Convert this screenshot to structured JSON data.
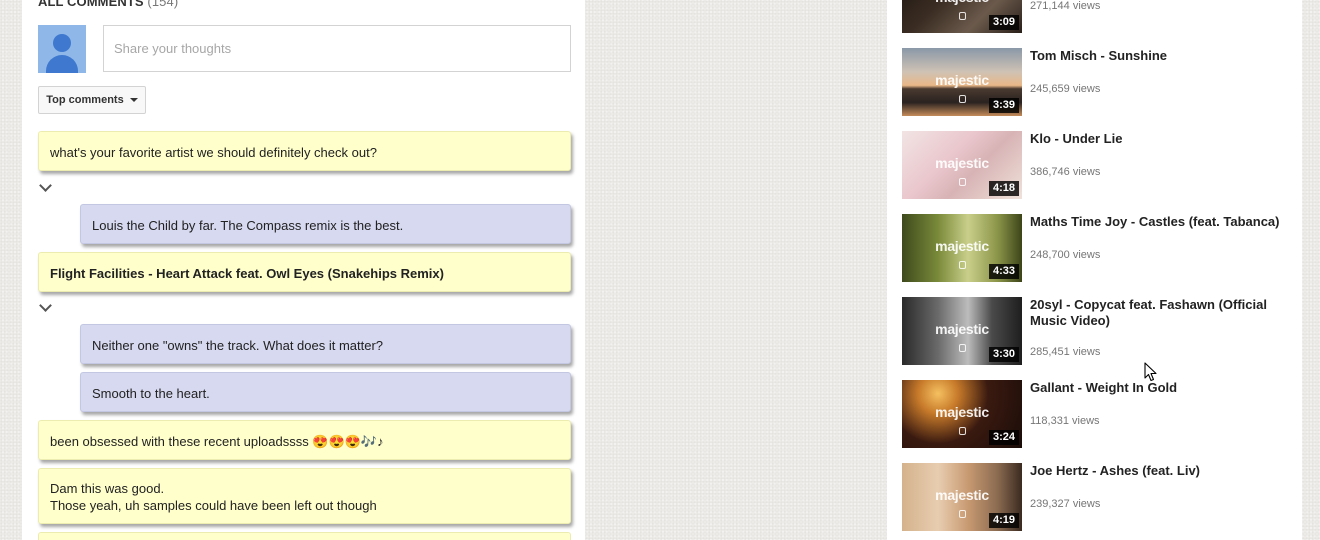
{
  "comments": {
    "header_title": "All Comments",
    "header_count": "(154)",
    "share_placeholder": "Share your thoughts",
    "sort_label": "Top comments",
    "items": [
      {
        "text": "what's your favorite artist we should definitely check out?",
        "kind": "comment"
      },
      {
        "text": "Louis the Child by far. The Compass remix is the best.",
        "kind": "reply"
      },
      {
        "text": "Flight Facilities - Heart Attack feat. Owl Eyes (Snakehips Remix)",
        "kind": "comment"
      },
      {
        "text": "Neither one \"owns\" the track. What does it matter?",
        "kind": "reply"
      },
      {
        "text": "Smooth to the heart.",
        "kind": "reply"
      },
      {
        "text": "been obsessed with these recent uploadssss 😍😍😍🎶♪",
        "kind": "comment"
      },
      {
        "line1": "Dam this was good.",
        "line2": "Those yeah, uh samples could have been left out though",
        "kind": "comment"
      }
    ]
  },
  "sidebar": {
    "logo_text": "majestic",
    "videos": [
      {
        "title": "",
        "views": "271,144 views",
        "duration": "3:09"
      },
      {
        "title": "Tom Misch - Sunshine",
        "views": "245,659 views",
        "duration": "3:39"
      },
      {
        "title": "Klo - Under Lie",
        "views": "386,746 views",
        "duration": "4:18"
      },
      {
        "title": "Maths Time Joy - Castles (feat. Tabanca)",
        "views": "248,700 views",
        "duration": "4:33"
      },
      {
        "title": "20syl - Copycat feat. Fashawn (Official Music Video)",
        "views": "285,451 views",
        "duration": "3:30"
      },
      {
        "title": "Gallant - Weight In Gold",
        "views": "118,331 views",
        "duration": "3:24"
      },
      {
        "title": "Joe Hertz - Ashes (feat. Liv)",
        "views": "239,327 views",
        "duration": "4:19"
      }
    ]
  },
  "colors": {
    "comment_bg": "#ffffcc",
    "reply_bg": "#d6d9f0",
    "avatar_bg": "#8fb7e8",
    "avatar_fg": "#3e79cf"
  }
}
